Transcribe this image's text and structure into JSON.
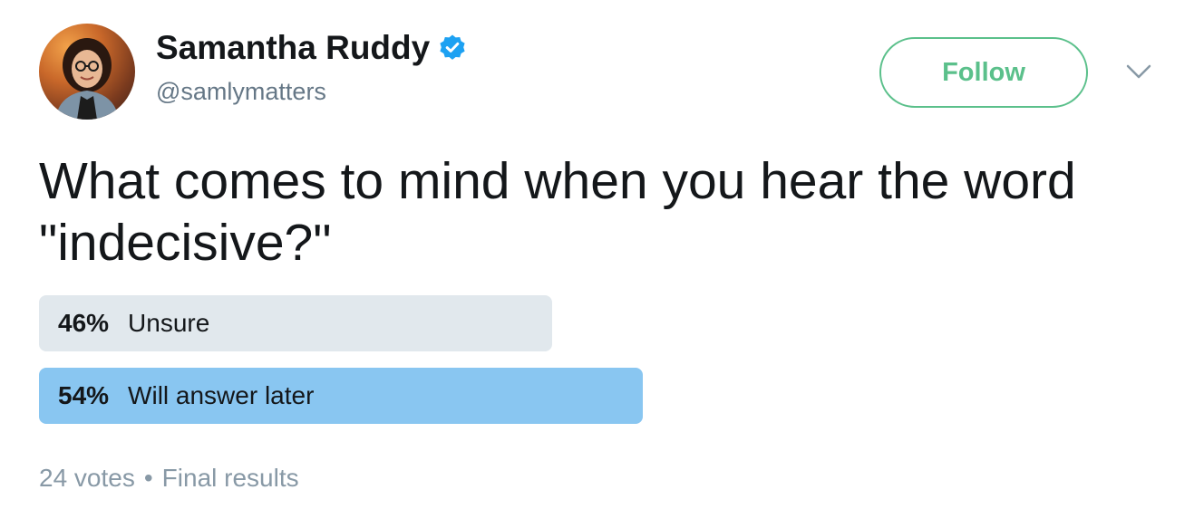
{
  "author": {
    "display_name": "Samantha Ruddy",
    "handle": "@samlymatters",
    "verified": true
  },
  "actions": {
    "follow_label": "Follow"
  },
  "tweet": {
    "text_line1": "What comes to mind when you hear the word",
    "text_line2": "\"indecisive?\""
  },
  "poll": {
    "options": [
      {
        "percent": "46%",
        "label": "Unsure",
        "share": 46
      },
      {
        "percent": "54%",
        "label": "Will answer later",
        "share": 54
      }
    ],
    "votes": "24 votes",
    "separator": "•",
    "status": "Final results"
  },
  "icons": {
    "verified": "verified-badge-icon",
    "caret": "chevron-down-icon"
  },
  "colors": {
    "follow_accent": "#5bc08b",
    "verified_blue": "#1da1f2",
    "poll_winner": "#89c6f1",
    "poll_other": "#e1e8ed",
    "muted_text": "#657786"
  }
}
